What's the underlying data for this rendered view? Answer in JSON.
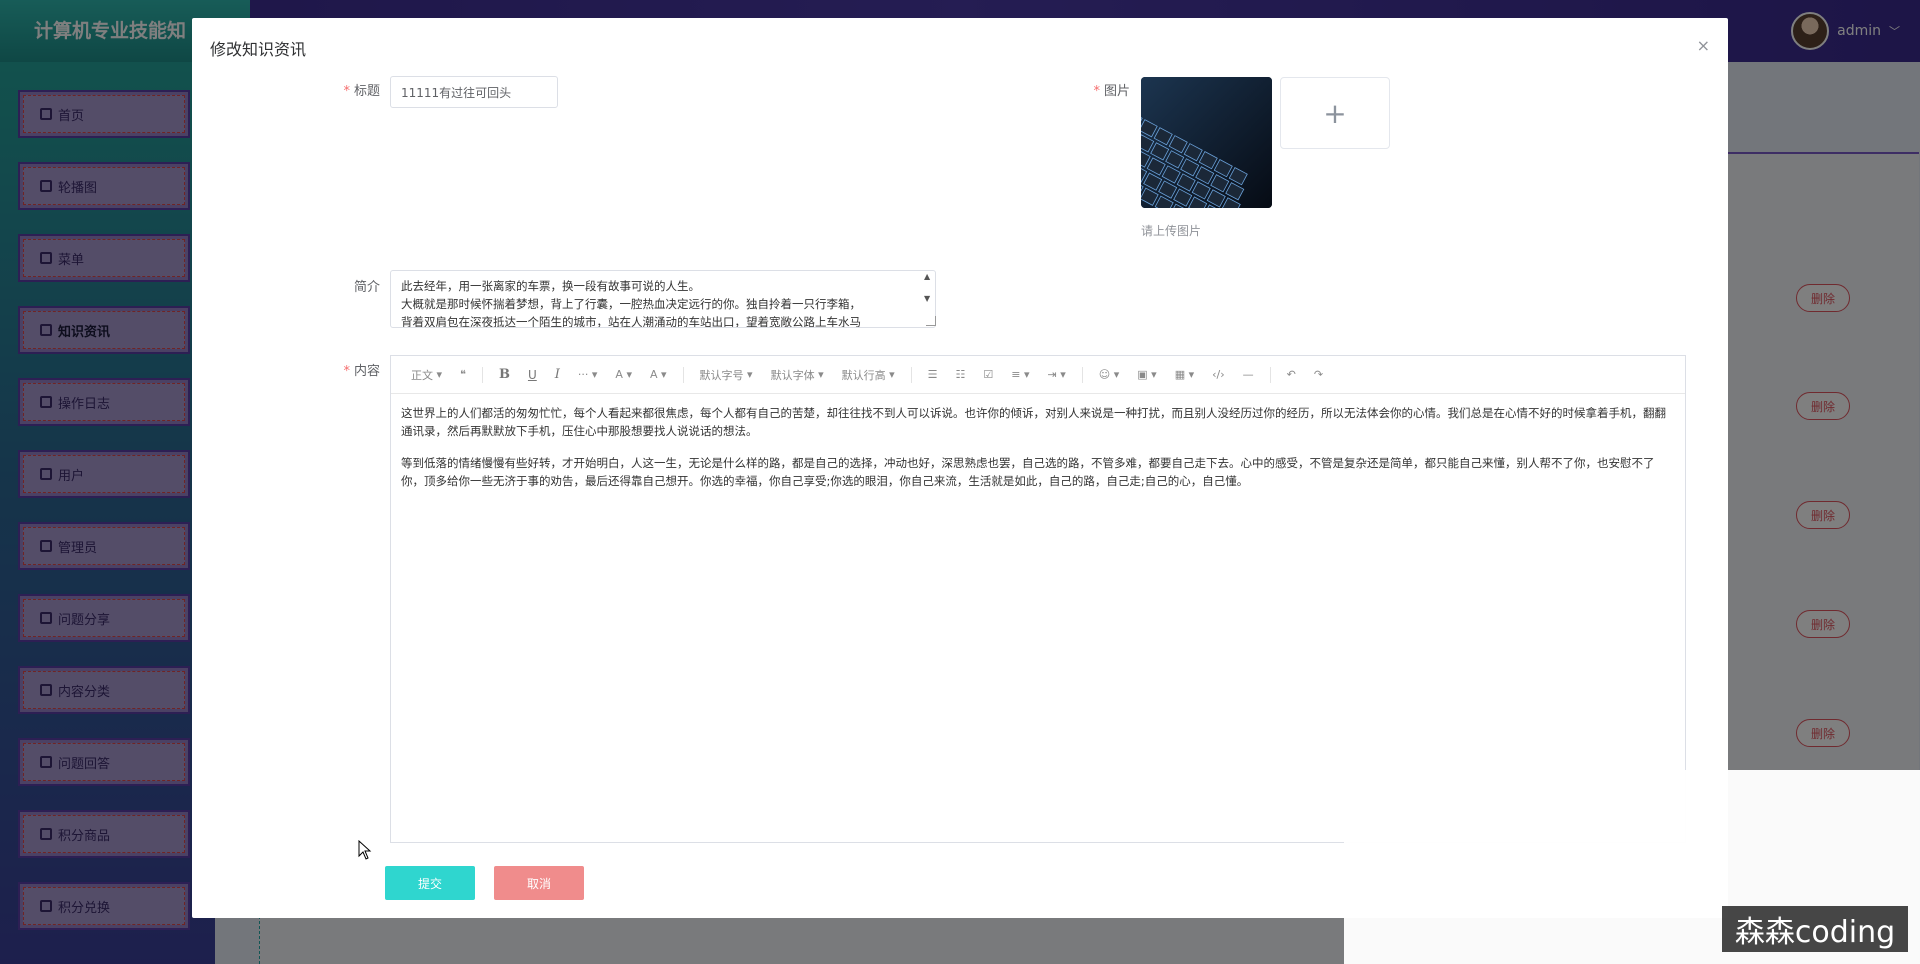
{
  "app": {
    "title": "计算机专业技能知",
    "user": "admin"
  },
  "sidebar": {
    "items": [
      {
        "label": "首页",
        "icon": "home-icon"
      },
      {
        "label": "轮播图",
        "icon": "carousel-icon"
      },
      {
        "label": "菜单",
        "icon": "menu-icon"
      },
      {
        "label": "知识资讯",
        "icon": "news-icon",
        "active": true
      },
      {
        "label": "操作日志",
        "icon": "log-icon"
      },
      {
        "label": "用户",
        "icon": "user-icon"
      },
      {
        "label": "管理员",
        "icon": "admin-icon"
      },
      {
        "label": "问题分享",
        "icon": "share-icon"
      },
      {
        "label": "内容分类",
        "icon": "category-icon"
      },
      {
        "label": "问题回答",
        "icon": "answer-icon"
      },
      {
        "label": "积分商品",
        "icon": "goods-icon"
      },
      {
        "label": "积分兑换",
        "icon": "exchange-icon"
      }
    ]
  },
  "table": {
    "delete_label": "删除"
  },
  "dialog": {
    "title": "修改知识资讯",
    "close_symbol": "×",
    "fields": {
      "title_label": "标题",
      "title_value": "11111有过往可回头",
      "image_label": "图片",
      "image_hint": "请上传图片",
      "add_symbol": "+",
      "brief_label": "简介",
      "brief_lines": [
        "此去经年，用一张离家的车票，换一段有故事可说的人生。",
        "大概就是那时候怀揣着梦想，背上了行囊，一腔热血决定远行的你。独自拎着一只行李箱，",
        "背着双肩包在深夜抵达一个陌生的城市，站在人潮涌动的车站出口，望着宽敞公路上车水马"
      ],
      "content_label": "内容"
    },
    "toolbar": {
      "paragraph": "正文",
      "quote": "❝",
      "bold": "B",
      "underline": "U",
      "italic": "I",
      "more": "···",
      "font_color": "A",
      "bg_color": "A",
      "font_size": "默认字号",
      "font_family": "默认字体",
      "line_height": "默认行高",
      "ul": "☰",
      "ol": "☷",
      "todo": "☑",
      "align": "≡",
      "indent": "⇥",
      "emoji": "☺",
      "image": "▣",
      "table": "▦",
      "code": "‹/›",
      "divider": "—",
      "undo": "↶",
      "redo": "↷"
    },
    "content_paragraphs": [
      "这世界上的人们都活的匆匆忙忙，每个人看起来都很焦虑，每个人都有自己的苦楚，却往往找不到人可以诉说。也许你的倾诉，对别人来说是一种打扰，而且别人没经历过你的经历，所以无法体会你的心情。我们总是在心情不好的时候拿着手机，翻翻通讯录，然后再默默放下手机，压住心中那股想要找人说说话的想法。",
      "等到低落的情绪慢慢有些好转，才开始明白，人这一生，无论是什么样的路，都是自己的选择，冲动也好，深思熟虑也罢，自己选的路，不管多难，都要自己走下去。心中的感受，不管是复杂还是简单，都只能自己来懂，别人帮不了你，也安慰不了你，顶多给你一些无济于事的劝告，最后还得靠自己想开。你选的幸福，你自己享受;你选的眼泪，你自己来流，生活就是如此，自己的路，自己走;自己的心，自己懂。"
    ],
    "submit_label": "提交",
    "cancel_label": "取消"
  },
  "watermark": "森森coding",
  "colors": {
    "submit": "#2fd6cf",
    "cancel": "#f08c8c",
    "required": "#f56c6c",
    "delete": "#e0555f"
  }
}
